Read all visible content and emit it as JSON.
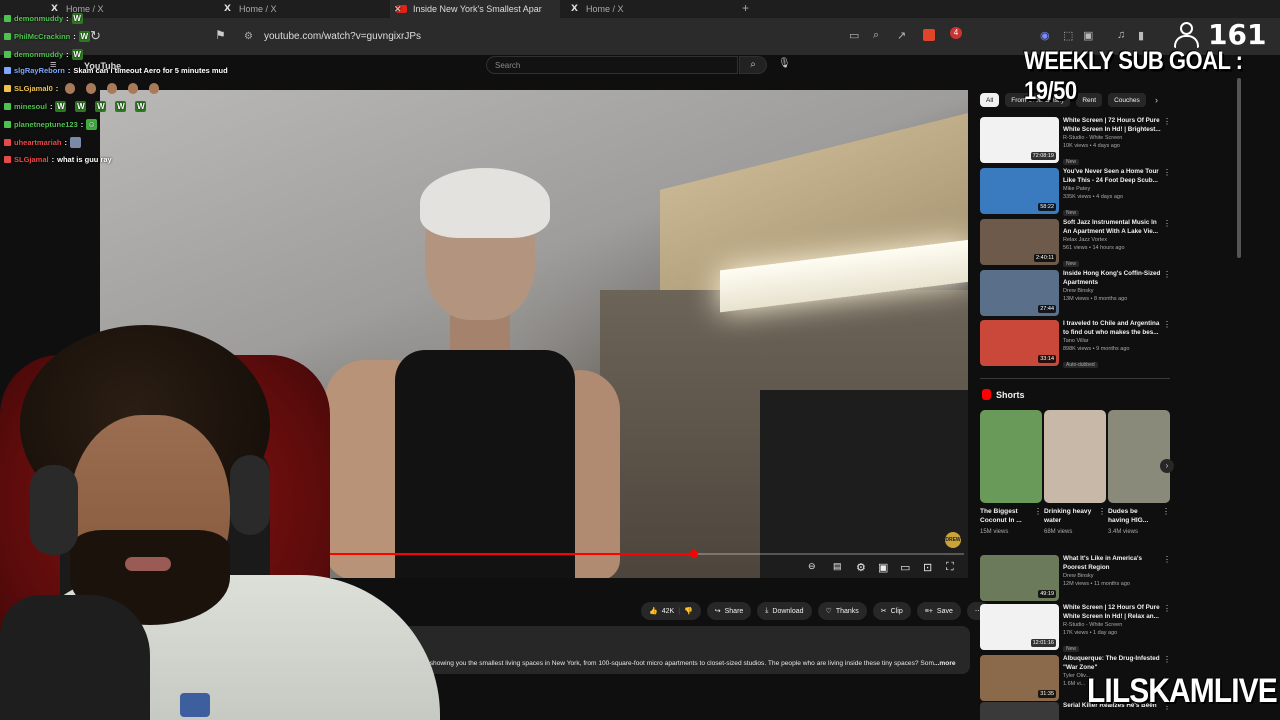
{
  "browser": {
    "tabs": [
      {
        "label": "Home / X",
        "icon": "x-logo"
      },
      {
        "label": "Home / X",
        "icon": "x-logo"
      },
      {
        "label": "Inside New York's Smallest Apar",
        "icon": "youtube-logo",
        "active": true
      },
      {
        "label": "Home / X",
        "icon": "x-logo"
      }
    ],
    "new_tab": "+",
    "url": "youtube.com/watch?v=guvngixrJPs"
  },
  "youtube": {
    "logo": "YouTube",
    "search_placeholder": "Search",
    "actions": {
      "likes": "42K",
      "share": "Share",
      "download": "Download",
      "thanks": "Thanks",
      "clip": "Clip",
      "save": "Save",
      "more": "⋯"
    },
    "description": "I'm gonna be showing you the smallest living spaces in New York, from 100-square-foot micro apartments to closet-sized studios.  The people who are living inside these tiny spaces? Som",
    "description_more": "...more",
    "video_progress": 0.59,
    "channel_badge": "DREW BINSKY",
    "chips": [
      "All",
      "From Drew Binsky",
      "Rent",
      "Couches"
    ],
    "recommended": [
      {
        "title": "White Screen | 72 Hours Of Pure White Screen In Hd! | Brightest...",
        "channel": "R-Studio - White Screen",
        "meta": "10K views • 4 days ago",
        "badge": "New",
        "duration": "72:08:19",
        "thumb": "#f2f2f2"
      },
      {
        "title": "You've Never Seen a Home Tour Like This - 24 Foot Deep Scub...",
        "channel": "Mike Patey",
        "meta": "335K views • 4 days ago",
        "badge": "New",
        "duration": "58:22",
        "thumb": "#3a7bbf"
      },
      {
        "title": "Soft Jazz Instrumental Music In An Apartment With A Lake Vie...",
        "channel": "Relax Jazz Vortex",
        "meta": "561 views • 14 hours ago",
        "badge": "New",
        "duration": "2:40:11",
        "thumb": "#6d5a4a"
      },
      {
        "title": "Inside Hong Kong's Coffin-Sized Apartments",
        "channel": "Drew Binsky",
        "meta": "13M views • 8 months ago",
        "badge": "",
        "duration": "27:44",
        "thumb": "#5a6f8a"
      },
      {
        "title": "I traveled to Chile and Argentina to find out who makes the bes...",
        "channel": "Tano Villar",
        "meta": "898K views • 9 months ago",
        "badge": "Auto-dubbed",
        "duration": "33:14",
        "thumb": "#c9483a"
      }
    ],
    "shorts_header": "Shorts",
    "shorts": [
      {
        "title": "The Biggest Coconut In ...",
        "views": "15M views",
        "thumb": "#6a9a5a"
      },
      {
        "title": "Drinking heavy water",
        "views": "68M views",
        "thumb": "#c7b8a8"
      },
      {
        "title": "Dudes be having HIG...",
        "views": "3.4M views",
        "thumb": "#8a8a7a"
      }
    ],
    "recommended2": [
      {
        "title": "What It's Like in America's Poorest Region",
        "channel": "Drew Binsky",
        "meta": "12M views • 11 months ago",
        "badge": "",
        "duration": "49:19",
        "thumb": "#6a7a5a"
      },
      {
        "title": "White Screen | 12 Hours Of Pure White Screen In Hd! | Relax an...",
        "channel": "R-Studio - White Screen",
        "meta": "17K views • 1 day ago",
        "badge": "New",
        "duration": "12:01:16",
        "thumb": "#f2f2f2"
      },
      {
        "title": "Albuquerque: The Drug-Infested \"War Zone\"",
        "channel": "Tyler Oliv...",
        "meta": "1.6M vi...",
        "badge": "",
        "duration": "31:35",
        "thumb": "#8a6a4a"
      },
      {
        "title": "Serial Killer Realizes He's Been",
        "channel": "",
        "meta": "",
        "badge": "",
        "duration": "",
        "thumb": "#3a3a3a"
      }
    ]
  },
  "chat": [
    {
      "user": "demonmuddy",
      "color": "#4ec24e",
      "message": "",
      "emote": "W"
    },
    {
      "user": "PhilMcCrackinn",
      "color": "#4ec24e",
      "message": "",
      "emote": "W"
    },
    {
      "user": "demonmuddy",
      "color": "#4ec24e",
      "message": "",
      "emote": "W"
    },
    {
      "user": "slgRayReborn",
      "color": "#7ea8ff",
      "message": "Skam can i timeout Aero for 5 minutes mud",
      "emote": ""
    },
    {
      "user": "SLGjamal0",
      "color": "#f0c24a",
      "message": "",
      "emote": "faces"
    },
    {
      "user": "minesoul",
      "color": "#4ec24e",
      "message": "",
      "emote": "WWWWW"
    },
    {
      "user": "planetneptune123",
      "color": "#4ec24e",
      "message": "",
      "emote": "frog"
    },
    {
      "user": "uheartmariah",
      "color": "#e64a4a",
      "message": "",
      "emote": "img"
    },
    {
      "user": "SLGjamal",
      "color": "#e64a4a",
      "message": "what is guu ray",
      "emote": ""
    }
  ],
  "overlay": {
    "viewer_count": "161",
    "sub_goal": "WEEKLY SUB GOAL : 19/50",
    "brand": "LILSKAMLIVE"
  }
}
